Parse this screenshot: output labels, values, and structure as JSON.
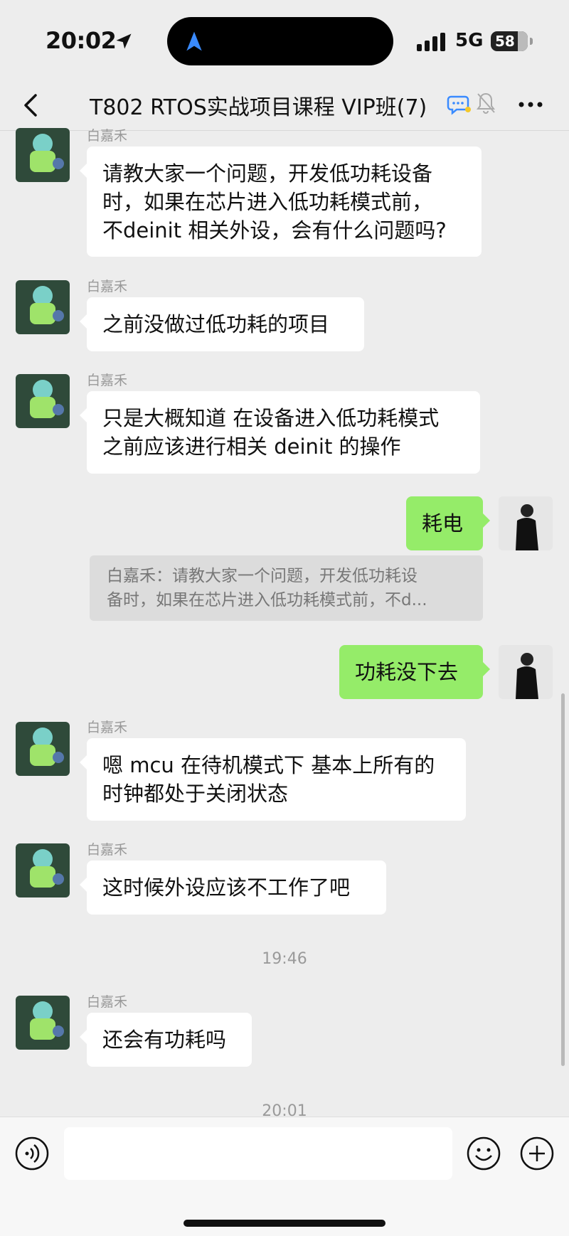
{
  "status_bar": {
    "time": "20:02",
    "network": "5G",
    "battery": "58"
  },
  "header": {
    "title": "T802 RTOS实战项目课程 VIP班(7)"
  },
  "messages": [
    {
      "sender": "白嘉禾",
      "side": "left",
      "lines": [
        "请教大家一个问题，开发低功耗设备",
        "时，如果在芯片进入低功耗模式前，",
        "不deinit 相关外设，会有什么问题吗?"
      ]
    },
    {
      "sender": "白嘉禾",
      "side": "left",
      "lines": [
        "之前没做过低功耗的项目"
      ]
    },
    {
      "sender": "白嘉禾",
      "side": "left",
      "lines": [
        "只是大概知道 在设备进入低功耗模式",
        "之前应该进行相关 deinit 的操作"
      ]
    },
    {
      "side": "right",
      "lines": [
        "耗电"
      ]
    },
    {
      "side": "right",
      "lines": [
        "功耗没下去"
      ]
    },
    {
      "sender": "白嘉禾",
      "side": "left",
      "lines": [
        "嗯 mcu 在待机模式下 基本上所有的",
        "时钟都处于关闭状态"
      ]
    },
    {
      "sender": "白嘉禾",
      "side": "left",
      "lines": [
        "这时候外设应该不工作了吧"
      ]
    },
    {
      "sender": "白嘉禾",
      "side": "left",
      "lines": [
        "还会有功耗吗"
      ]
    }
  ],
  "quote": {
    "lines": [
      "白嘉禾：请教大家一个问题，开发低功耗设",
      "备时，如果在芯片进入低功耗模式前，不d..."
    ]
  },
  "timestamps": [
    "19:46",
    "20:01"
  ],
  "input": {
    "value": "",
    "placeholder": ""
  },
  "colors": {
    "background": "#ededed",
    "self_bubble": "#95ec69",
    "other_bubble": "#ffffff",
    "meta_text": "#999999"
  },
  "icons": [
    "location-arrow-icon",
    "navigation-icon",
    "signal-icon",
    "battery-icon",
    "back-chevron-icon",
    "chat-badge-icon",
    "mute-bell-icon",
    "more-dots-icon",
    "voice-icon",
    "emoji-icon",
    "plus-icon"
  ]
}
